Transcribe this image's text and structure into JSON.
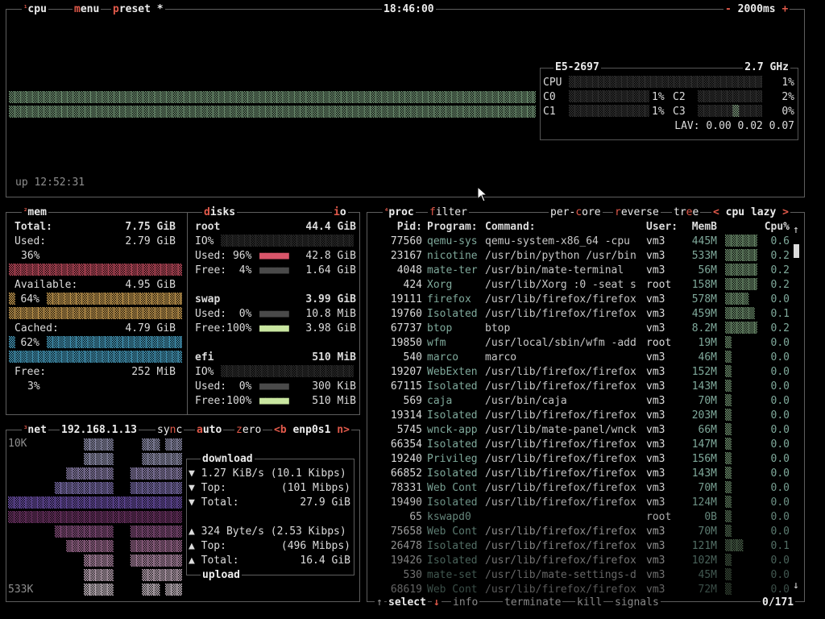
{
  "cpu": {
    "title_num": "¹",
    "title": "cpu",
    "menu_label": "menu",
    "preset_label": "preset",
    "preset_star": "*",
    "clock": "18:46:00",
    "minus": "-",
    "interval": "2000ms",
    "plus": "+",
    "uptime": "up 12:52:31",
    "model": "E5-2697",
    "freq": "2.7 GHz",
    "total_label": "CPU",
    "total_pct": "1%",
    "cores": [
      {
        "name": "C0",
        "pct": "1%",
        "level": 0.01
      },
      {
        "name": "C1",
        "pct": "1%",
        "level": 0.01
      },
      {
        "name": "C2",
        "pct": "2%",
        "level": 0.02
      },
      {
        "name": "C3",
        "pct": "0%",
        "level": 0.0
      }
    ],
    "lav": "LAV: 0.00 0.02 0.07",
    "graph_color": "#7fa683"
  },
  "mem": {
    "title_num": "²",
    "title": "mem",
    "total_label": "Total:",
    "total_val": "7.75 GiB",
    "used_label": "Used:",
    "used_val": "2.79 GiB",
    "used_pct": "36%",
    "available_label": "Available:",
    "available_val": "4.95 GiB",
    "available_pct": "64%",
    "cached_label": "Cached:",
    "cached_val": "4.79 GiB",
    "cached_pct": "62%",
    "free_label": "Free:",
    "free_val": "252 MiB",
    "free_pct": "3%",
    "used_color": "#d9556a",
    "available_color": "#e3b15c",
    "cached_color": "#4fb0d6"
  },
  "disks": {
    "title": "disks",
    "io_label": "io",
    "items": [
      {
        "name": "root",
        "size": "44.4 GiB",
        "io": "IO%",
        "used_label": "Used: 96%",
        "used_val": "42.8 GiB",
        "used_level": 0.96,
        "free_label": "Free:  4%",
        "free_val": "1.64 GiB",
        "free_level": 0.04
      },
      {
        "name": "swap",
        "size": "3.99 GiB",
        "io": "",
        "used_label": "Used:  0%",
        "used_val": "10.8 MiB",
        "used_level": 0.0,
        "free_label": "Free:100%",
        "free_val": "3.98 GiB",
        "free_level": 1.0
      },
      {
        "name": "efi",
        "size": "510 MiB",
        "io": "IO%",
        "used_label": "Used:  0%",
        "used_val": "300 KiB",
        "used_level": 0.0,
        "free_label": "Free:100%",
        "free_val": "510 MiB",
        "free_level": 1.0
      }
    ]
  },
  "net": {
    "title_num": "³",
    "title": "net",
    "ip": "192.168.1.13",
    "sync": "sync",
    "auto": "auto",
    "zero": "zero",
    "prev": "<b",
    "iface": "enp0s1",
    "next": "n>",
    "scale_top": "10K",
    "scale_bottom": "533K",
    "download_label": "download",
    "dl_rate": "1.27 KiB/s (10.1 Kibps)",
    "dl_top_label": "Top:",
    "dl_top": "(101 Mibps)",
    "dl_total_label": "Total:",
    "dl_total": "27.9 GiB",
    "ul_rate": "324 Byte/s (2.53 Kibps)",
    "ul_top_label": "Top:",
    "ul_top": "(496 Mibps)",
    "ul_total_label": "Total:",
    "ul_total": "16.4 GiB",
    "upload_label": "upload"
  },
  "proc": {
    "title_num": "⁴",
    "title": "proc",
    "filter_label": "filter",
    "per_core": "per-core",
    "reverse": "reverse",
    "tree": "tree",
    "sort_prev": "<",
    "sort": "cpu lazy",
    "sort_next": ">",
    "headers": {
      "pid": "Pid:",
      "program": "Program:",
      "command": "Command:",
      "user": "User:",
      "mem": "MemB",
      "cpu": "Cpu%"
    },
    "rows": [
      {
        "pid": "77560",
        "program": "qemu-sys",
        "command": "qemu-system-x86_64 -cpu",
        "user": "vm3",
        "mem": "445M",
        "cpu": "0.6"
      },
      {
        "pid": "23167",
        "program": "nicotine",
        "command": "/usr/bin/python /usr/bin",
        "user": "vm3",
        "mem": "533M",
        "cpu": "0.2"
      },
      {
        "pid": "4048",
        "program": "mate-ter",
        "command": "/usr/bin/mate-terminal",
        "user": "vm3",
        "mem": "56M",
        "cpu": "0.2"
      },
      {
        "pid": "424",
        "program": "Xorg",
        "command": "/usr/lib/Xorg :0 -seat s",
        "user": "root",
        "mem": "158M",
        "cpu": "0.2"
      },
      {
        "pid": "19111",
        "program": "firefox",
        "command": "/usr/lib/firefox/firefox",
        "user": "vm3",
        "mem": "578M",
        "cpu": "0.0"
      },
      {
        "pid": "19760",
        "program": "Isolated",
        "command": "/usr/lib/firefox/firefox",
        "user": "vm3",
        "mem": "459M",
        "cpu": "0.1"
      },
      {
        "pid": "67737",
        "program": "btop",
        "command": "btop",
        "user": "vm3",
        "mem": "8.2M",
        "cpu": "0.2"
      },
      {
        "pid": "19850",
        "program": "wfm",
        "command": "/usr/local/sbin/wfm -add",
        "user": "root",
        "mem": "19M",
        "cpu": "0.0"
      },
      {
        "pid": "540",
        "program": "marco",
        "command": "marco",
        "user": "vm3",
        "mem": "46M",
        "cpu": "0.0"
      },
      {
        "pid": "19207",
        "program": "WebExten",
        "command": "/usr/lib/firefox/firefox",
        "user": "vm3",
        "mem": "152M",
        "cpu": "0.0"
      },
      {
        "pid": "67115",
        "program": "Isolated",
        "command": "/usr/lib/firefox/firefox",
        "user": "vm3",
        "mem": "143M",
        "cpu": "0.0"
      },
      {
        "pid": "569",
        "program": "caja",
        "command": "/usr/bin/caja",
        "user": "vm3",
        "mem": "70M",
        "cpu": "0.0"
      },
      {
        "pid": "19314",
        "program": "Isolated",
        "command": "/usr/lib/firefox/firefox",
        "user": "vm3",
        "mem": "203M",
        "cpu": "0.0"
      },
      {
        "pid": "5745",
        "program": "wnck-app",
        "command": "/usr/lib/mate-panel/wnck",
        "user": "vm3",
        "mem": "66M",
        "cpu": "0.0"
      },
      {
        "pid": "66354",
        "program": "Isolated",
        "command": "/usr/lib/firefox/firefox",
        "user": "vm3",
        "mem": "147M",
        "cpu": "0.0"
      },
      {
        "pid": "19240",
        "program": "Privileg",
        "command": "/usr/lib/firefox/firefox",
        "user": "vm3",
        "mem": "156M",
        "cpu": "0.0"
      },
      {
        "pid": "66852",
        "program": "Isolated",
        "command": "/usr/lib/firefox/firefox",
        "user": "vm3",
        "mem": "143M",
        "cpu": "0.0"
      },
      {
        "pid": "78331",
        "program": "Web Cont",
        "command": "/usr/lib/firefox/firefox",
        "user": "vm3",
        "mem": "70M",
        "cpu": "0.0"
      },
      {
        "pid": "19490",
        "program": "Isolated",
        "command": "/usr/lib/firefox/firefox",
        "user": "vm3",
        "mem": "124M",
        "cpu": "0.0"
      },
      {
        "pid": "65",
        "program": "kswapd0",
        "command": "",
        "user": "root",
        "mem": "0B",
        "cpu": "0.0"
      },
      {
        "pid": "75658",
        "program": "Web Cont",
        "command": "/usr/lib/firefox/firefox",
        "user": "vm3",
        "mem": "70M",
        "cpu": "0.0"
      },
      {
        "pid": "26478",
        "program": "Isolated",
        "command": "/usr/lib/firefox/firefox",
        "user": "vm3",
        "mem": "121M",
        "cpu": "0.1"
      },
      {
        "pid": "19426",
        "program": "Isolated",
        "command": "/usr/lib/firefox/firefox",
        "user": "vm3",
        "mem": "102M",
        "cpu": "0.0"
      },
      {
        "pid": "530",
        "program": "mate-set",
        "command": "/usr/lib/mate-settings-d",
        "user": "vm3",
        "mem": "45M",
        "cpu": "0.0"
      },
      {
        "pid": "68619",
        "program": "Web Cont",
        "command": "/usr/lib/firefox/firefox",
        "user": "vm3",
        "mem": "72M",
        "cpu": "0.0"
      }
    ],
    "footer": {
      "up_arrow": "↑",
      "select": "select",
      "down_arrow": "↓",
      "info": "info",
      "terminate": "terminate",
      "kill": "kill",
      "signals": "signals",
      "count": "0/171"
    }
  }
}
